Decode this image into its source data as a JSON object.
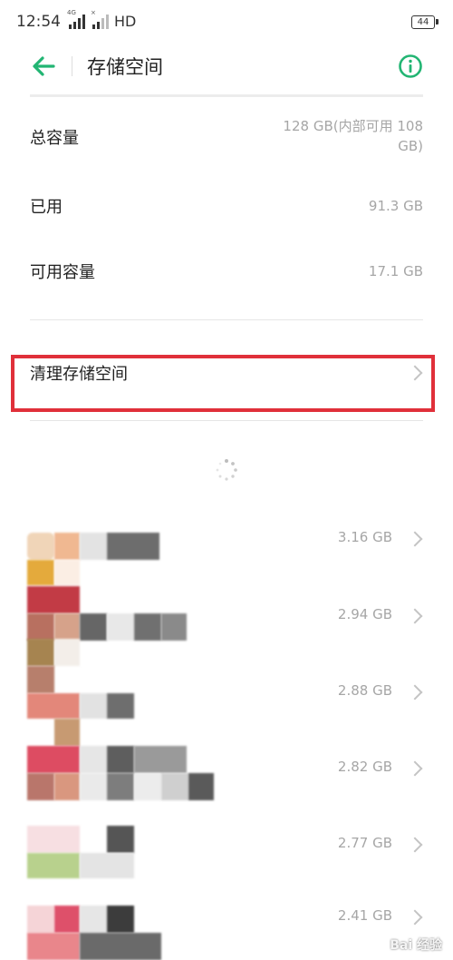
{
  "status_bar": {
    "time": "12:54",
    "network_tag_1": "4G",
    "network_tag_2": "×",
    "hd": "HD",
    "battery": "44"
  },
  "app_bar": {
    "title": "存储空间",
    "back_icon": "back-arrow-icon",
    "info_icon": "info-icon"
  },
  "storage": {
    "total": {
      "label": "总容量",
      "value_line1": "128 GB(内部可用 108",
      "value_line2": "GB)"
    },
    "used": {
      "label": "已用",
      "value": "91.3 GB"
    },
    "available": {
      "label": "可用容量",
      "value": "17.1 GB"
    }
  },
  "clean": {
    "label": "清理存储空间"
  },
  "apps": [
    {
      "size": "3.16 GB"
    },
    {
      "size": "2.94 GB"
    },
    {
      "size": "2.88 GB"
    },
    {
      "size": "2.82 GB"
    },
    {
      "size": "2.77 GB"
    },
    {
      "size": "2.41 GB"
    }
  ],
  "watermark": "Bai 经验",
  "colors": {
    "accent": "#22b573",
    "highlight": "#e0303a",
    "muted": "#a6a6a6"
  }
}
